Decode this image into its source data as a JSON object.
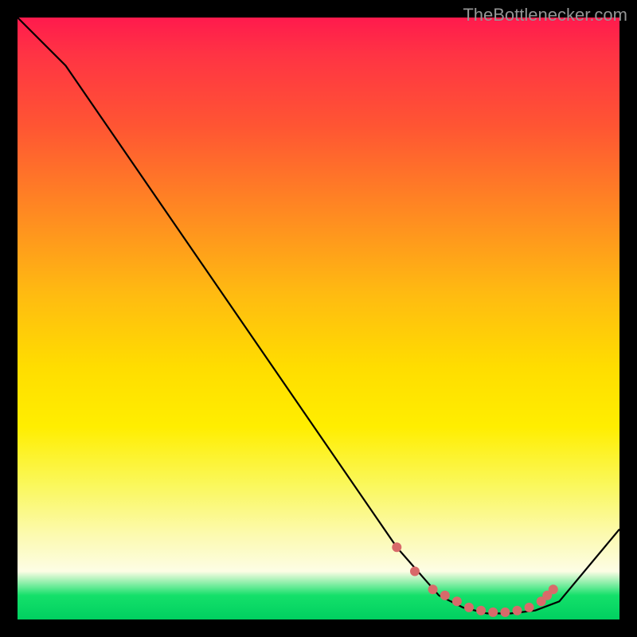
{
  "attribution": "TheBottlenecker.com",
  "chart_data": {
    "type": "line",
    "title": "",
    "xlabel": "",
    "ylabel": "",
    "xlim": [
      0,
      100
    ],
    "ylim": [
      0,
      100
    ],
    "series": [
      {
        "name": "curve",
        "x": [
          0,
          8,
          63,
          70,
          74,
          78,
          82,
          86,
          90,
          100
        ],
        "y": [
          100,
          92,
          12,
          4,
          2,
          1,
          1,
          1.5,
          3,
          15
        ]
      }
    ],
    "highlight_points": {
      "x": [
        63,
        66,
        69,
        71,
        73,
        75,
        77,
        79,
        81,
        83,
        85,
        87,
        88,
        89
      ],
      "y": [
        12,
        8,
        5,
        4,
        3,
        2,
        1.5,
        1.2,
        1.2,
        1.5,
        2,
        3,
        4,
        5
      ]
    },
    "gradient_stops": [
      {
        "pos": 0.0,
        "color": "#ff1a4d"
      },
      {
        "pos": 0.4,
        "color": "#ffaa00"
      },
      {
        "pos": 0.7,
        "color": "#ffee00"
      },
      {
        "pos": 0.92,
        "color": "#fdfde5"
      },
      {
        "pos": 1.0,
        "color": "#00d060"
      }
    ]
  }
}
